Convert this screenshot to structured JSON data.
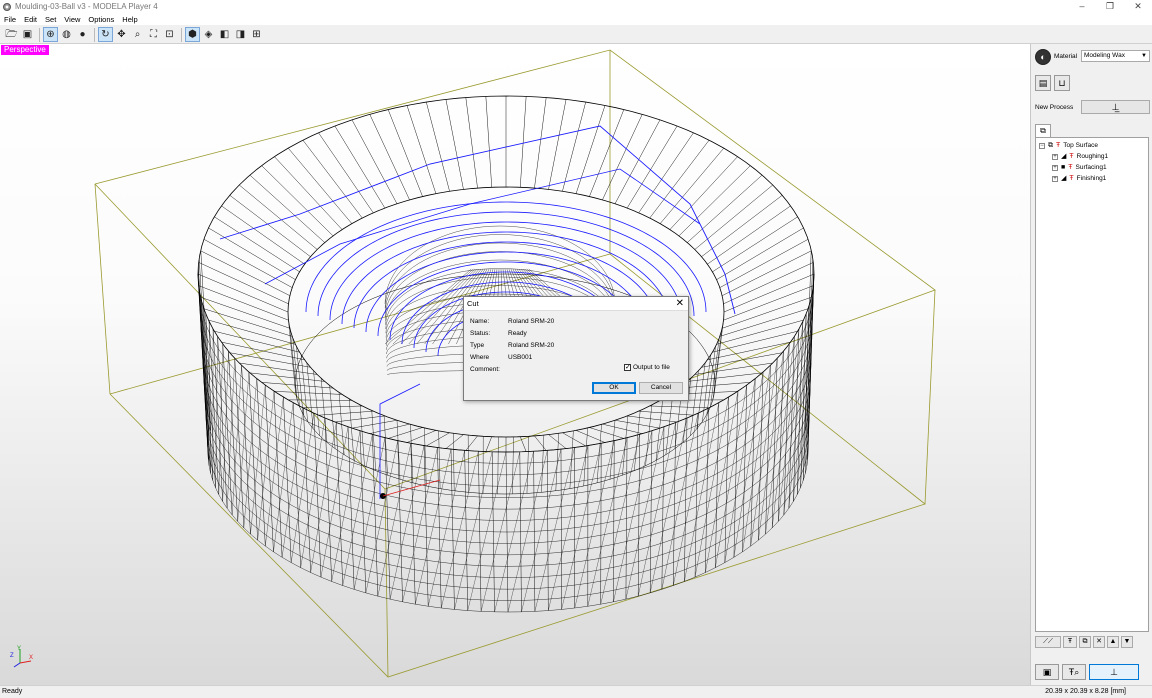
{
  "window": {
    "title": "Moulding-03-Ball v3 - MODELA Player 4",
    "controls": {
      "minimize": "–",
      "maximize": "❐",
      "close": "✕"
    }
  },
  "menu": [
    "File",
    "Edit",
    "Set",
    "View",
    "Options",
    "Help"
  ],
  "viewport": {
    "mode_label": "Perspective",
    "axis_labels": {
      "x": "X",
      "y": "Y",
      "z": "Z"
    }
  },
  "dialog": {
    "title": "Cut",
    "close": "✕",
    "fields": [
      {
        "key": "Name:",
        "value": "Roland SRM-20"
      },
      {
        "key": "Status:",
        "value": "Ready"
      },
      {
        "key": "Type",
        "value": "Roland SRM-20"
      },
      {
        "key": "Where",
        "value": "USB001"
      },
      {
        "key": "Comment:",
        "value": ""
      }
    ],
    "output_to_file": {
      "label": "Output to file",
      "checked": true
    },
    "ok_label": "OK",
    "cancel_label": "Cancel"
  },
  "panel": {
    "material_label": "Material",
    "material_value": "Modeling Wax",
    "new_process_label": "New Process",
    "tree": {
      "root": "Top Surface",
      "children": [
        "Roughing1",
        "Surfacing1",
        "Finishing1"
      ]
    }
  },
  "status": {
    "left": "Ready",
    "right": "20.39 x 20.39 x 8.28 [mm]"
  },
  "colors": {
    "perspective_badge": "#ff00ff",
    "toolpath": "#1a1aff",
    "bounding_box": "#9a9a30",
    "mesh": "#000000"
  }
}
